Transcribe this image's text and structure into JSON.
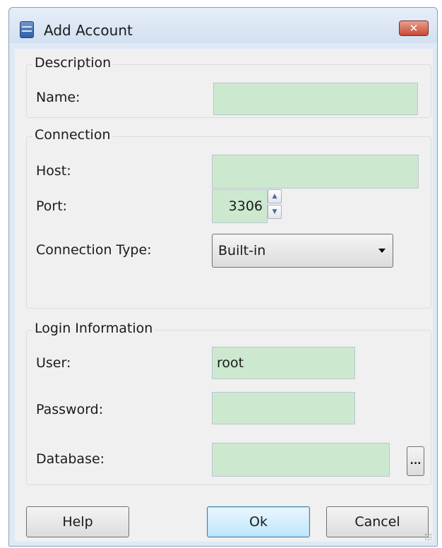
{
  "window": {
    "title": "Add Account",
    "close_label": "✕"
  },
  "description": {
    "legend": "Description",
    "name_label": "Name:",
    "name_value": ""
  },
  "connection": {
    "legend": "Connection",
    "host_label": "Host:",
    "host_value": "",
    "port_label": "Port:",
    "port_value": "3306",
    "type_label": "Connection Type:",
    "type_value": "Built-in"
  },
  "login": {
    "legend": "Login Information",
    "user_label": "User:",
    "user_value": "root",
    "password_label": "Password:",
    "password_value": "",
    "database_label": "Database:",
    "database_value": "",
    "browse_label": "..."
  },
  "buttons": {
    "help": "Help",
    "ok": "Ok",
    "cancel": "Cancel"
  },
  "colors": {
    "field_bg": "#cce9d0",
    "window_frame": "#dfe9f5",
    "close_button": "#c74a34"
  }
}
